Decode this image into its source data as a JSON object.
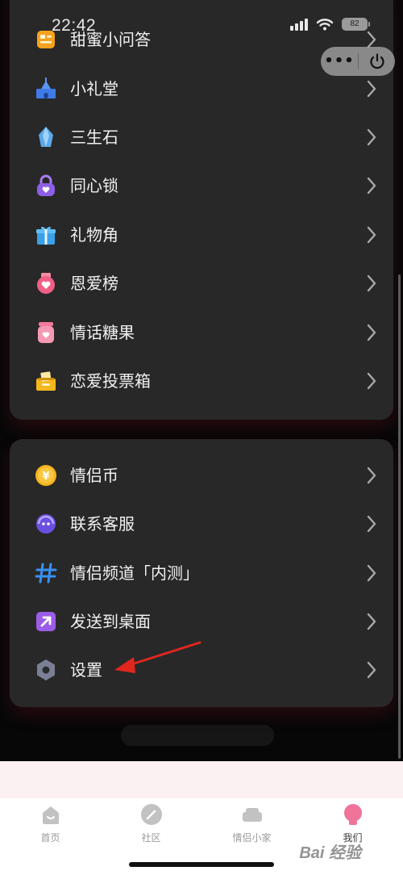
{
  "status_bar": {
    "time": "22:42",
    "battery": "82"
  },
  "capsule": {
    "more_label": "•••"
  },
  "menu_top": {
    "items": [
      {
        "label": "甜蜜小问答",
        "icon": "quiz-card-icon"
      },
      {
        "label": "小礼堂",
        "icon": "chapel-icon"
      },
      {
        "label": "三生石",
        "icon": "crystal-stone-icon"
      },
      {
        "label": "同心锁",
        "icon": "heart-lock-icon"
      },
      {
        "label": "礼物角",
        "icon": "gift-box-icon"
      },
      {
        "label": "恩爱榜",
        "icon": "love-badge-icon"
      },
      {
        "label": "情话糖果",
        "icon": "candy-jar-icon"
      },
      {
        "label": "恋爱投票箱",
        "icon": "vote-box-icon"
      }
    ]
  },
  "menu_bottom": {
    "items": [
      {
        "label": "情侣币",
        "icon": "coin-icon"
      },
      {
        "label": "联系客服",
        "icon": "customer-service-icon"
      },
      {
        "label": "情侣频道「内测」",
        "icon": "hashtag-icon"
      },
      {
        "label": "发送到桌面",
        "icon": "send-to-desktop-icon"
      },
      {
        "label": "设置",
        "icon": "settings-gear-icon"
      }
    ]
  },
  "tabbar": {
    "tabs": [
      {
        "label": "首页",
        "icon": "home-icon",
        "active": false
      },
      {
        "label": "社区",
        "icon": "community-pen-icon",
        "active": false
      },
      {
        "label": "情侣小家",
        "icon": "sofa-icon",
        "active": false
      },
      {
        "label": "我们",
        "icon": "couple-avatar-icon",
        "active": true
      }
    ]
  },
  "watermark": {
    "text": "Bai 经验"
  },
  "colors": {
    "card_bg": "#282828",
    "page_bg": "#070707",
    "accent_pink": "#f0739a",
    "arrow_red": "#e0261f"
  }
}
